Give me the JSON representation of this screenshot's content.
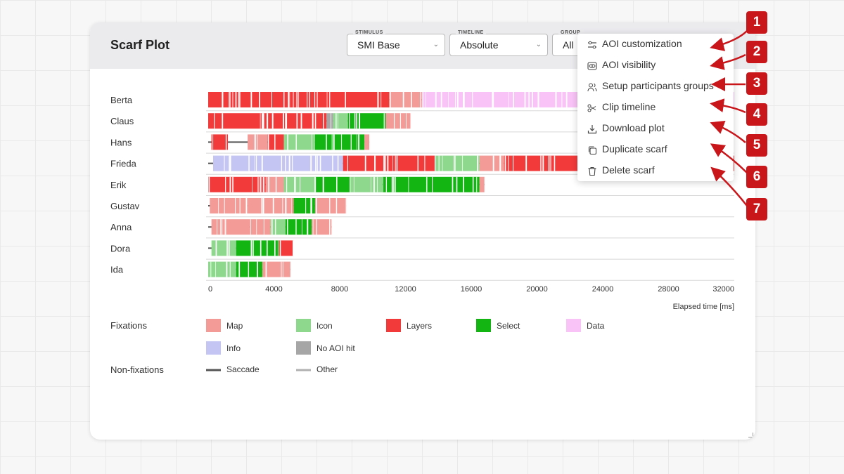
{
  "panel": {
    "title": "Scarf Plot",
    "stimulus": {
      "legend": "STIMULUS",
      "value": "SMI Base"
    },
    "timeline": {
      "legend": "TIMELINE",
      "value": "Absolute"
    },
    "group": {
      "legend": "GROUP",
      "value": "All"
    }
  },
  "menu": {
    "items": [
      {
        "label": "AOI customization",
        "icon": "sliders-icon"
      },
      {
        "label": "AOI visibility",
        "icon": "eye-icon"
      },
      {
        "label": "Setup participants groups",
        "icon": "users-icon"
      },
      {
        "label": "Clip timeline",
        "icon": "scissors-icon"
      },
      {
        "label": "Download plot",
        "icon": "download-icon"
      },
      {
        "label": "Duplicate scarf",
        "icon": "copy-icon"
      },
      {
        "label": "Delete scarf",
        "icon": "trash-icon"
      }
    ]
  },
  "callouts": [
    "1",
    "2",
    "3",
    "4",
    "5",
    "6",
    "7"
  ],
  "colors": {
    "map": "#f29b97",
    "icon": "#8ed88e",
    "layers": "#f23a3a",
    "select": "#12b512",
    "data": "#f9c3f7",
    "info": "#c4c5f2",
    "no_aoi": "#a6a6a6",
    "saccade": "#555555",
    "other": "#b1b1b1",
    "callout": "#c8161b"
  },
  "chart_data": {
    "type": "scarf",
    "participants": [
      {
        "name": "Berta",
        "end": 32000,
        "segments": [
          [
            0,
            11000,
            "layers"
          ],
          [
            11000,
            13000,
            "map"
          ],
          [
            13000,
            22500,
            "data"
          ],
          [
            22500,
            32000,
            "data"
          ]
        ]
      },
      {
        "name": "Claus",
        "end": 12300,
        "segments": [
          [
            0,
            7200,
            "layers"
          ],
          [
            7200,
            7600,
            "no_aoi"
          ],
          [
            7600,
            8500,
            "icon"
          ],
          [
            8500,
            10800,
            "select"
          ],
          [
            10800,
            12300,
            "map"
          ]
        ]
      },
      {
        "name": "Hans",
        "end": 9800,
        "segments": [
          [
            200,
            1200,
            "layers"
          ],
          [
            1200,
            2400,
            "saccade"
          ],
          [
            2400,
            3600,
            "map"
          ],
          [
            3600,
            4600,
            "layers"
          ],
          [
            4600,
            6500,
            "icon"
          ],
          [
            6500,
            9500,
            "select"
          ],
          [
            9500,
            9800,
            "map"
          ]
        ]
      },
      {
        "name": "Frieda",
        "end": 32000,
        "segments": [
          [
            300,
            8200,
            "info"
          ],
          [
            8200,
            13800,
            "layers"
          ],
          [
            13800,
            16500,
            "icon"
          ],
          [
            16500,
            18000,
            "map"
          ],
          [
            18000,
            22500,
            "layers"
          ],
          [
            22500,
            32000,
            "layers"
          ]
        ]
      },
      {
        "name": "Erik",
        "end": 16800,
        "segments": [
          [
            0,
            3500,
            "layers"
          ],
          [
            3500,
            4600,
            "map"
          ],
          [
            4600,
            6500,
            "icon"
          ],
          [
            6500,
            8600,
            "select"
          ],
          [
            8600,
            10600,
            "icon"
          ],
          [
            10600,
            13200,
            "select"
          ],
          [
            13200,
            16500,
            "select"
          ],
          [
            16500,
            16800,
            "map"
          ]
        ]
      },
      {
        "name": "Gustav",
        "end": 8400,
        "segments": [
          [
            100,
            2400,
            "map"
          ],
          [
            2400,
            5200,
            "map"
          ],
          [
            5200,
            6500,
            "select"
          ],
          [
            6500,
            8400,
            "map"
          ]
        ]
      },
      {
        "name": "Anna",
        "end": 7500,
        "segments": [
          [
            200,
            2500,
            "map"
          ],
          [
            2500,
            3800,
            "map"
          ],
          [
            3800,
            4700,
            "icon"
          ],
          [
            4700,
            6300,
            "select"
          ],
          [
            6300,
            7500,
            "map"
          ]
        ]
      },
      {
        "name": "Dora",
        "end": 5200,
        "segments": [
          [
            200,
            1700,
            "icon"
          ],
          [
            1700,
            4300,
            "select"
          ],
          [
            4300,
            5200,
            "layers"
          ]
        ]
      },
      {
        "name": "Ida",
        "end": 5000,
        "segments": [
          [
            0,
            1700,
            "icon"
          ],
          [
            1700,
            3300,
            "select"
          ],
          [
            3300,
            5000,
            "map"
          ]
        ]
      }
    ],
    "x_ticks": [
      "0",
      "4000",
      "8000",
      "12000",
      "16000",
      "20000",
      "24000",
      "28000",
      "32000"
    ],
    "xlim": [
      0,
      32000
    ],
    "xlabel": "Elapsed time [ms]",
    "legend": {
      "fixations_label": "Fixations",
      "fixations": [
        {
          "key": "map",
          "label": "Map"
        },
        {
          "key": "icon",
          "label": "Icon"
        },
        {
          "key": "layers",
          "label": "Layers"
        },
        {
          "key": "select",
          "label": "Select"
        },
        {
          "key": "data",
          "label": "Data"
        },
        {
          "key": "info",
          "label": "Info"
        },
        {
          "key": "no_aoi",
          "label": "No AOI hit"
        }
      ],
      "non_fixations_label": "Non-fixations",
      "non_fixations": [
        {
          "key": "saccade",
          "label": "Saccade"
        },
        {
          "key": "other",
          "label": "Other"
        }
      ]
    }
  }
}
